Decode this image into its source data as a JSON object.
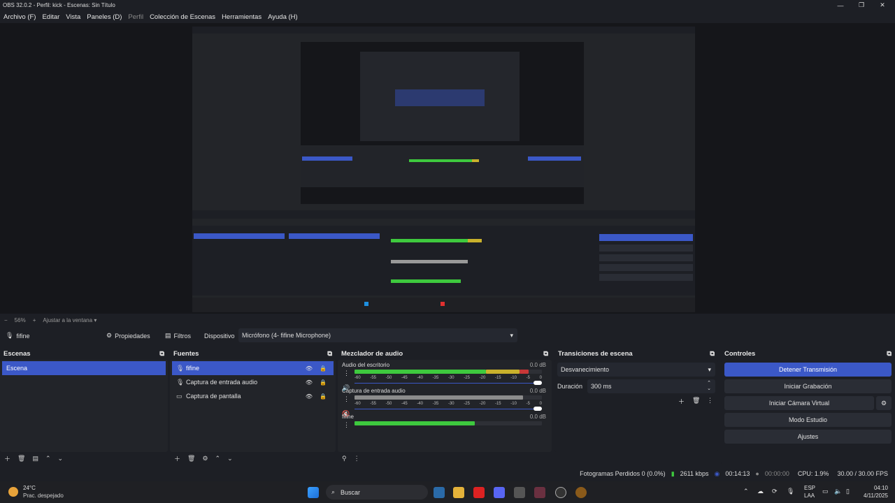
{
  "window": {
    "title": "OBS 32.0.2 - Perfil: kick - Escenas: Sin Título"
  },
  "menu": [
    "Archivo (F)",
    "Editar",
    "Vista",
    "Paneles (D)",
    "Perfil",
    "Colección de Escenas",
    "Herramientas",
    "Ayuda (H)"
  ],
  "zoom": {
    "minus": "−",
    "value": "56%",
    "plus": "+",
    "fit": "Ajustar a la ventana"
  },
  "source_toolbar": {
    "source": "fifine",
    "properties": "Propiedades",
    "filters": "Filtros",
    "device_label": "Dispositivo",
    "device_value": "Micrófono (4- fifine Microphone)"
  },
  "scenes": {
    "title": "Escenas",
    "items": [
      "Escena"
    ]
  },
  "sources": {
    "title": "Fuentes",
    "items": [
      "fifine",
      "Captura de entrada audio",
      "Captura de pantalla"
    ]
  },
  "mixer": {
    "title": "Mezclador de audio",
    "channels": [
      {
        "name": "Audio del escritorio",
        "db": "0.0 dB",
        "level": 0.93
      },
      {
        "name": "Captura de entrada audio",
        "db": "0.0 dB",
        "level": 0.9
      },
      {
        "name": "fifine",
        "db": "0.0 dB",
        "level": 0.64
      }
    ],
    "ticks": [
      "-60",
      "-55",
      "-50",
      "-45",
      "-40",
      "-35",
      "-30",
      "-25",
      "-20",
      "-15",
      "-10",
      "-5",
      "0"
    ]
  },
  "transitions": {
    "title": "Transiciones de escena",
    "type": "Desvanecimiento",
    "duration_label": "Duración",
    "duration_value": "300 ms"
  },
  "controls": {
    "title": "Controles",
    "stop_stream": "Detener Transmisión",
    "start_record": "Iniciar Grabación",
    "virtual_cam": "Iniciar Cámara Virtual",
    "studio": "Modo Estudio",
    "settings": "Ajustes"
  },
  "status": {
    "dropped": "Fotogramas Perdidos 0 (0.0%)",
    "bitrate": "2611 kbps",
    "stream_time": "00:14:13",
    "rec_time": "00:00:00",
    "cpu": "CPU: 1.9%",
    "fps": "30.00 / 30.00 FPS"
  },
  "taskbar": {
    "temp": "24°C",
    "weather": "Prac. despejado",
    "search": "Buscar",
    "lang": "ESP",
    "lang2": "LAA",
    "time": "04:10",
    "date": "4/11/2025"
  },
  "colors": {
    "accent": "#3b58c7",
    "green": "#3ec93e",
    "yellow": "#c9b12c",
    "red": "#c83737",
    "bg": "#1d1f25"
  }
}
